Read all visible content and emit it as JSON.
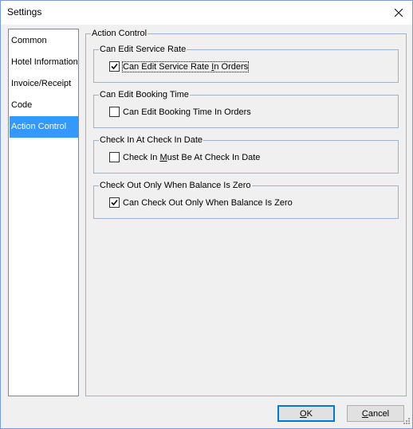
{
  "window": {
    "title": "Settings"
  },
  "nav": {
    "items": [
      {
        "label": "Common",
        "selected": false
      },
      {
        "label": "Hotel Information",
        "selected": false
      },
      {
        "label": "Invoice/Receipt",
        "selected": false
      },
      {
        "label": "Code",
        "selected": false
      },
      {
        "label": "Action Control",
        "selected": true
      }
    ]
  },
  "action_control": {
    "title": "Action Control",
    "groups": [
      {
        "title": "Can Edit Service Rate",
        "checkbox": {
          "pre": "Can Edit Service Rate ",
          "mn": "I",
          "post": "n Orders",
          "checked": true
        }
      },
      {
        "title": "Can Edit Booking Time",
        "checkbox": {
          "pre": "Can Edit Booking Time In Orders",
          "mn": "",
          "post": "",
          "checked": false
        }
      },
      {
        "title": "Check In At Check In Date",
        "checkbox": {
          "pre": "Check In ",
          "mn": "M",
          "post": "ust Be At Check In Date",
          "checked": false
        }
      },
      {
        "title": "Check Out Only When Balance Is Zero",
        "checkbox": {
          "pre": "Can Check Out Only When Balance Is Zero",
          "mn": "",
          "post": "",
          "checked": true
        }
      }
    ]
  },
  "buttons": {
    "ok": {
      "mn": "O",
      "rest": "K"
    },
    "cancel": {
      "mn": "C",
      "rest": "ancel"
    }
  },
  "colors": {
    "selection": "#3399ff",
    "group_border": "#99b4d1",
    "default_button_border": "#0078d7"
  }
}
